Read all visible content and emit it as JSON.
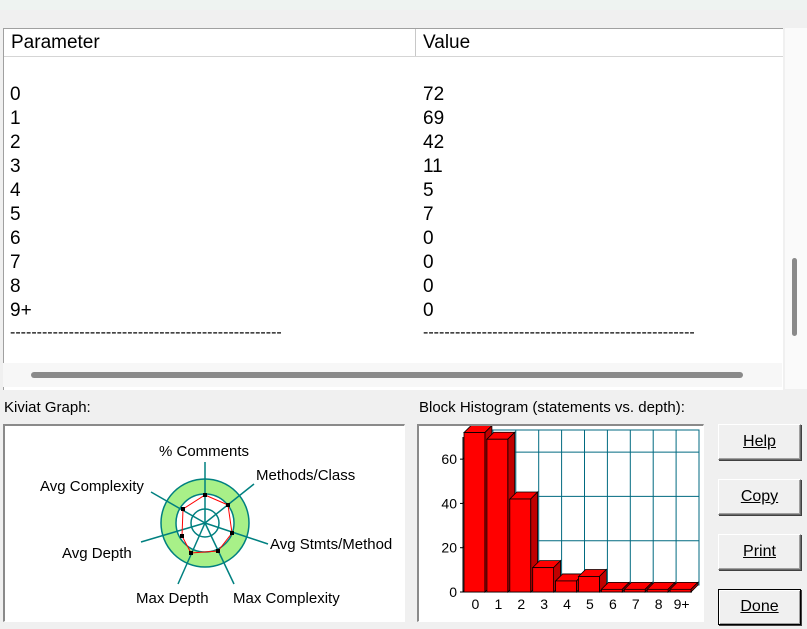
{
  "table": {
    "columns": [
      "Parameter",
      "Value"
    ],
    "rows": [
      {
        "parameter": "0",
        "value": "72"
      },
      {
        "parameter": "1",
        "value": "69"
      },
      {
        "parameter": "2",
        "value": "42"
      },
      {
        "parameter": "3",
        "value": "11"
      },
      {
        "parameter": "4",
        "value": "5"
      },
      {
        "parameter": "5",
        "value": "7"
      },
      {
        "parameter": "6",
        "value": "0"
      },
      {
        "parameter": "7",
        "value": "0"
      },
      {
        "parameter": "8",
        "value": "0"
      },
      {
        "parameter": "9+",
        "value": "0"
      }
    ],
    "separator": "---------------------------------------------------"
  },
  "kiviat": {
    "label": "Kiviat Graph:",
    "axes": [
      "% Comments",
      "Methods/Class",
      "Avg Stmts/Method",
      "Max Complexity",
      "Max Depth",
      "Avg Depth",
      "Avg Complexity"
    ]
  },
  "histogram": {
    "label": "Block Histogram (statements vs. depth):"
  },
  "buttons": {
    "help": "Help",
    "copy": "Copy",
    "print": "Print",
    "done": "Done"
  },
  "colors": {
    "bar": "#ff0000",
    "grid": "#006a80",
    "kiviat_ring": "#a8f088",
    "kiviat_axis": "#008080"
  },
  "chart_data": {
    "type": "bar",
    "categories": [
      "0",
      "1",
      "2",
      "3",
      "4",
      "5",
      "6",
      "7",
      "8",
      "9+"
    ],
    "values": [
      72,
      69,
      42,
      11,
      5,
      7,
      0,
      0,
      0,
      0
    ],
    "title": "Block Histogram (statements vs. depth):",
    "xlabel": "",
    "ylabel": "",
    "ylim": [
      0,
      70
    ],
    "yticks": [
      0,
      20,
      40,
      60
    ],
    "grid": true
  }
}
